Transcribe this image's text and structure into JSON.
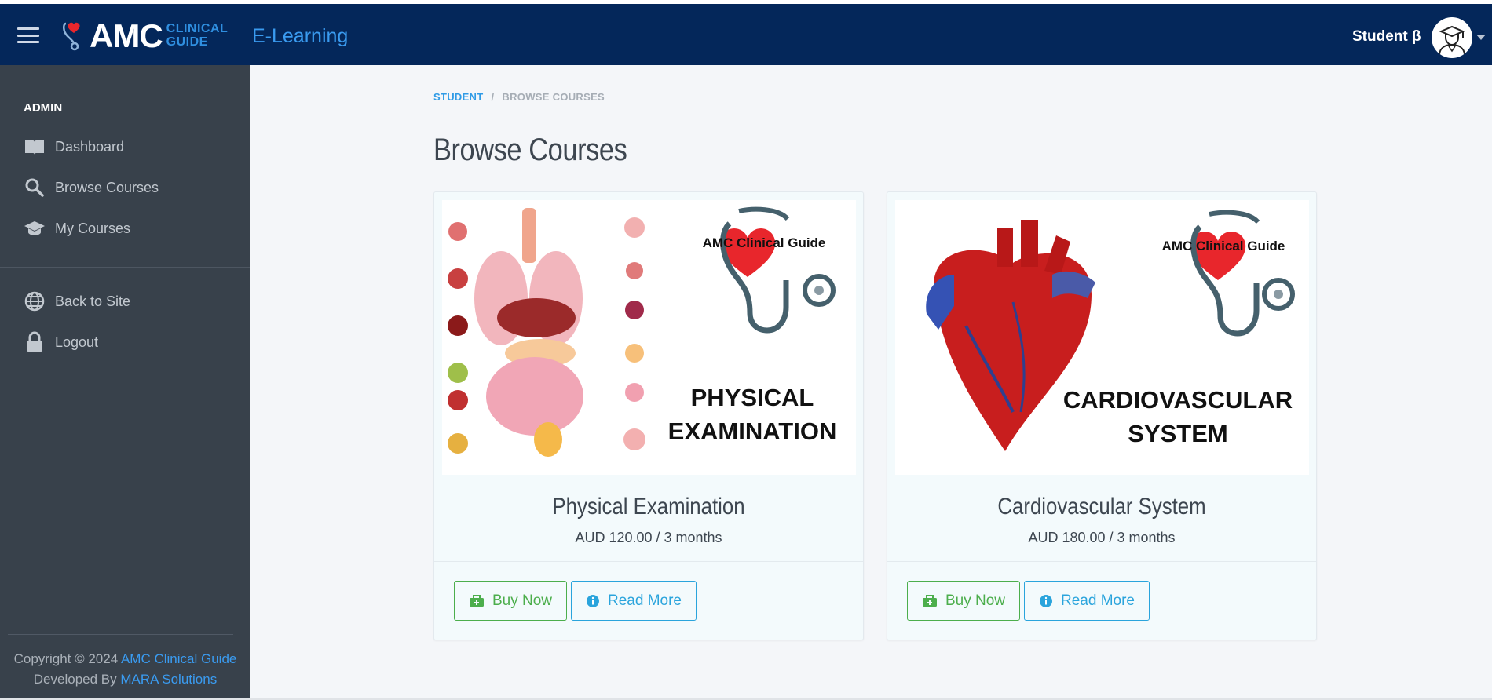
{
  "header": {
    "logo_main": "AMC",
    "logo_sub_line1": "CLINICAL",
    "logo_sub_line2": "GUIDE",
    "app_name": "E-Learning",
    "user_name": "Student β"
  },
  "sidebar": {
    "section_label": "ADMIN",
    "items": [
      {
        "label": "Dashboard",
        "icon": "book-open-icon"
      },
      {
        "label": "Browse Courses",
        "icon": "search-icon"
      },
      {
        "label": "My Courses",
        "icon": "graduation-cap-icon"
      },
      {
        "label": "Back to Site",
        "icon": "globe-icon"
      },
      {
        "label": "Logout",
        "icon": "lock-icon"
      }
    ],
    "footer": {
      "copyright_prefix": "Copyright © 2024",
      "copyright_link": "AMC Clinical Guide",
      "developed_prefix": "Developed By",
      "developed_link": "MARA Solutions"
    }
  },
  "breadcrumb": {
    "root": "STUDENT",
    "separator": "/",
    "current": "BROWSE COURSES"
  },
  "page": {
    "title": "Browse Courses"
  },
  "courses": [
    {
      "title": "Physical Examination",
      "price": "AUD 120.00 / 3 months",
      "image_brand": "AMC Clinical Guide",
      "image_line1": "PHYSICAL",
      "image_line2": "EXAMINATION",
      "buy_label": "Buy Now",
      "read_label": "Read More"
    },
    {
      "title": "Cardiovascular System",
      "price": "AUD 180.00 / 3 months",
      "image_brand": "AMC Clinical Guide",
      "image_line1": "CARDIOVASCULAR",
      "image_line2": "SYSTEM",
      "buy_label": "Buy Now",
      "read_label": "Read More"
    }
  ],
  "colors": {
    "topbar": "#04275a",
    "sidebar": "#38414b",
    "accent_blue": "#3a9bf0",
    "buy_green": "#4cae4c",
    "read_blue": "#2aa4dc"
  }
}
